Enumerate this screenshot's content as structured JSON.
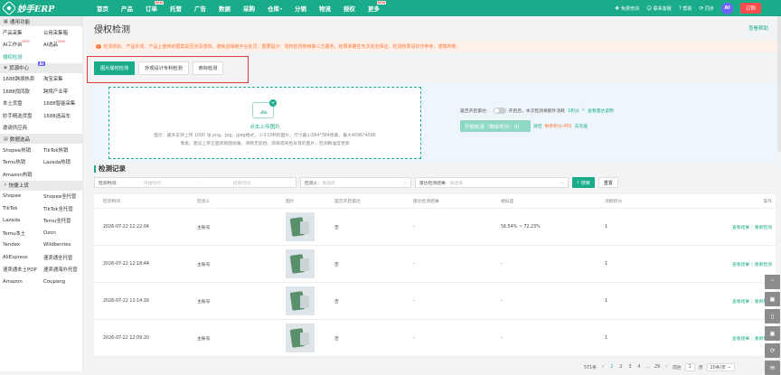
{
  "topbar": {
    "logo": "妙手ERP",
    "nav": [
      {
        "label": "首页"
      },
      {
        "label": "产品"
      },
      {
        "label": "订单",
        "badge": "NEW"
      },
      {
        "label": "托管"
      },
      {
        "label": "广告"
      },
      {
        "label": "数据"
      },
      {
        "label": "采购"
      },
      {
        "label": "仓库",
        "caret": "▾"
      },
      {
        "label": "分销"
      },
      {
        "label": "物流"
      },
      {
        "label": "授权"
      },
      {
        "label": "更多",
        "badge": "NEW"
      }
    ],
    "right": [
      {
        "icon": "❖",
        "label": "免费培训"
      },
      {
        "icon": "☺",
        "label": "联系客服"
      },
      {
        "icon": "?",
        "label": "帮助"
      },
      {
        "icon": "⟳",
        "label": "同步"
      }
    ],
    "ai": "AI",
    "order_btn": "订购"
  },
  "sidebar": {
    "sections": [
      {
        "title": "通用功能",
        "items": [
          "产品采集",
          "公用采集箱",
          "AI工作台",
          "AI选品",
          "侵权检测"
        ],
        "new_marks": [
          "NEW",
          "NEW"
        ]
      },
      {
        "title": "货源中心",
        "ai_tag": "AI",
        "items": [
          "1688跨境热卖",
          "淘宝采集",
          "1688找同款",
          "跨境产业带",
          "本土货盘",
          "1688智能采集",
          "妙手精选货盘",
          "1688选品车",
          "邀请供应商"
        ]
      },
      {
        "title": "数据选品",
        "items": [
          "Shopee热销",
          "TikTok热销",
          "Temu热销",
          "Lazada热销",
          "Amazon热销"
        ]
      },
      {
        "title": "快捷上货",
        "items": [
          "Shopee",
          "Shopee全托管",
          "TikTok",
          "TikTok全托管",
          "Lazada",
          "Temu全托管",
          "Temu本土",
          "Ozon",
          "Yandex",
          "Wildberries",
          "AliExpress",
          "速卖通全托管",
          "速卖通本土POP",
          "速卖通海外托管",
          "Amazon",
          "Coupang"
        ]
      }
    ]
  },
  "page": {
    "title": "侵权检测",
    "help": "查看帮助",
    "notice": "检测商标、产品外观、产品上使用的图案是否涉及侵权，避免店铺被平台处罚。重要提示：侵权检测使用第三方服务，结果准确性无法完全保证，检测结果请仅作参考，谨慎判断。"
  },
  "tabs": [
    {
      "label": "图片版权检测",
      "active": true
    },
    {
      "label": "外观设计专利检测",
      "active": false
    },
    {
      "label": "商标检测",
      "active": false
    }
  ],
  "upload": {
    "label": "点击上传图片",
    "tip1": "图示：最多支持上传 1000 张 png、jpg、jpeg格式，小于10M的图片；尺寸最小384*384像素，最大4096*4096",
    "tip2": "像素。建议上传正面或侧面视角，清晰无遮挡，简单或纯色背景的图片，检测精准度更高",
    "switch_label": "是否开启雷达：",
    "radar_desc": "开启后，本次检测将额外消耗",
    "radar_cost": "1积分",
    "radar_link": "查看雷达说明",
    "start_btn": "开始检测（剩余积分：0）",
    "empty": "清空",
    "remaining": "剩余积分:401",
    "recharge": "去充值"
  },
  "records": {
    "title": "检测记录",
    "filters": {
      "time_label": "检测时间:",
      "start_ph": "开始时间",
      "to": "-",
      "end_ph": "结束时间",
      "user_label": "检测人:",
      "user_ph": "请选择",
      "result_label": "雷达检测结果:",
      "result_ph": "请选择",
      "search": "搜索",
      "reset": "重置"
    },
    "columns": [
      "检测时间",
      "检测人",
      "图片",
      "是否开启雷达",
      "雷达检测结果",
      "相似度",
      "消耗积分",
      "操作"
    ],
    "rows": [
      {
        "time": "2026-07-22 12:22:04",
        "user": "主账号",
        "radar": "否",
        "radar_result": "-",
        "similarity": "56.54% ~ 72.23%",
        "points": "1"
      },
      {
        "time": "2026-07-22 12:18:44",
        "user": "主账号",
        "radar": "否",
        "radar_result": "-",
        "similarity": "-",
        "points": "1"
      },
      {
        "time": "2026-07-22 12:14:16",
        "user": "主账号",
        "radar": "否",
        "radar_result": "-",
        "similarity": "-",
        "points": "1"
      },
      {
        "time": "2026-07-22 12:09:20",
        "user": "主账号",
        "radar": "否",
        "radar_result": "-",
        "similarity": "-",
        "points": "1"
      }
    ],
    "actions": {
      "view": "查看结果",
      "recheck": "重新检测"
    }
  },
  "pager": {
    "total": "571条",
    "prev": "‹",
    "pages": [
      "1",
      "2",
      "3",
      "4",
      "…",
      "29"
    ],
    "next": "›",
    "goto": "前往",
    "page_input": "1",
    "page_unit": "页",
    "size": "20条/页"
  },
  "rail": [
    "⌃",
    "▣",
    "▯",
    "▣",
    "⟳",
    "✉"
  ],
  "colors": {
    "brand": "#1aab8a",
    "warning": "#ff7a3d",
    "danger": "#e53935",
    "ai": "#6c63ff"
  }
}
